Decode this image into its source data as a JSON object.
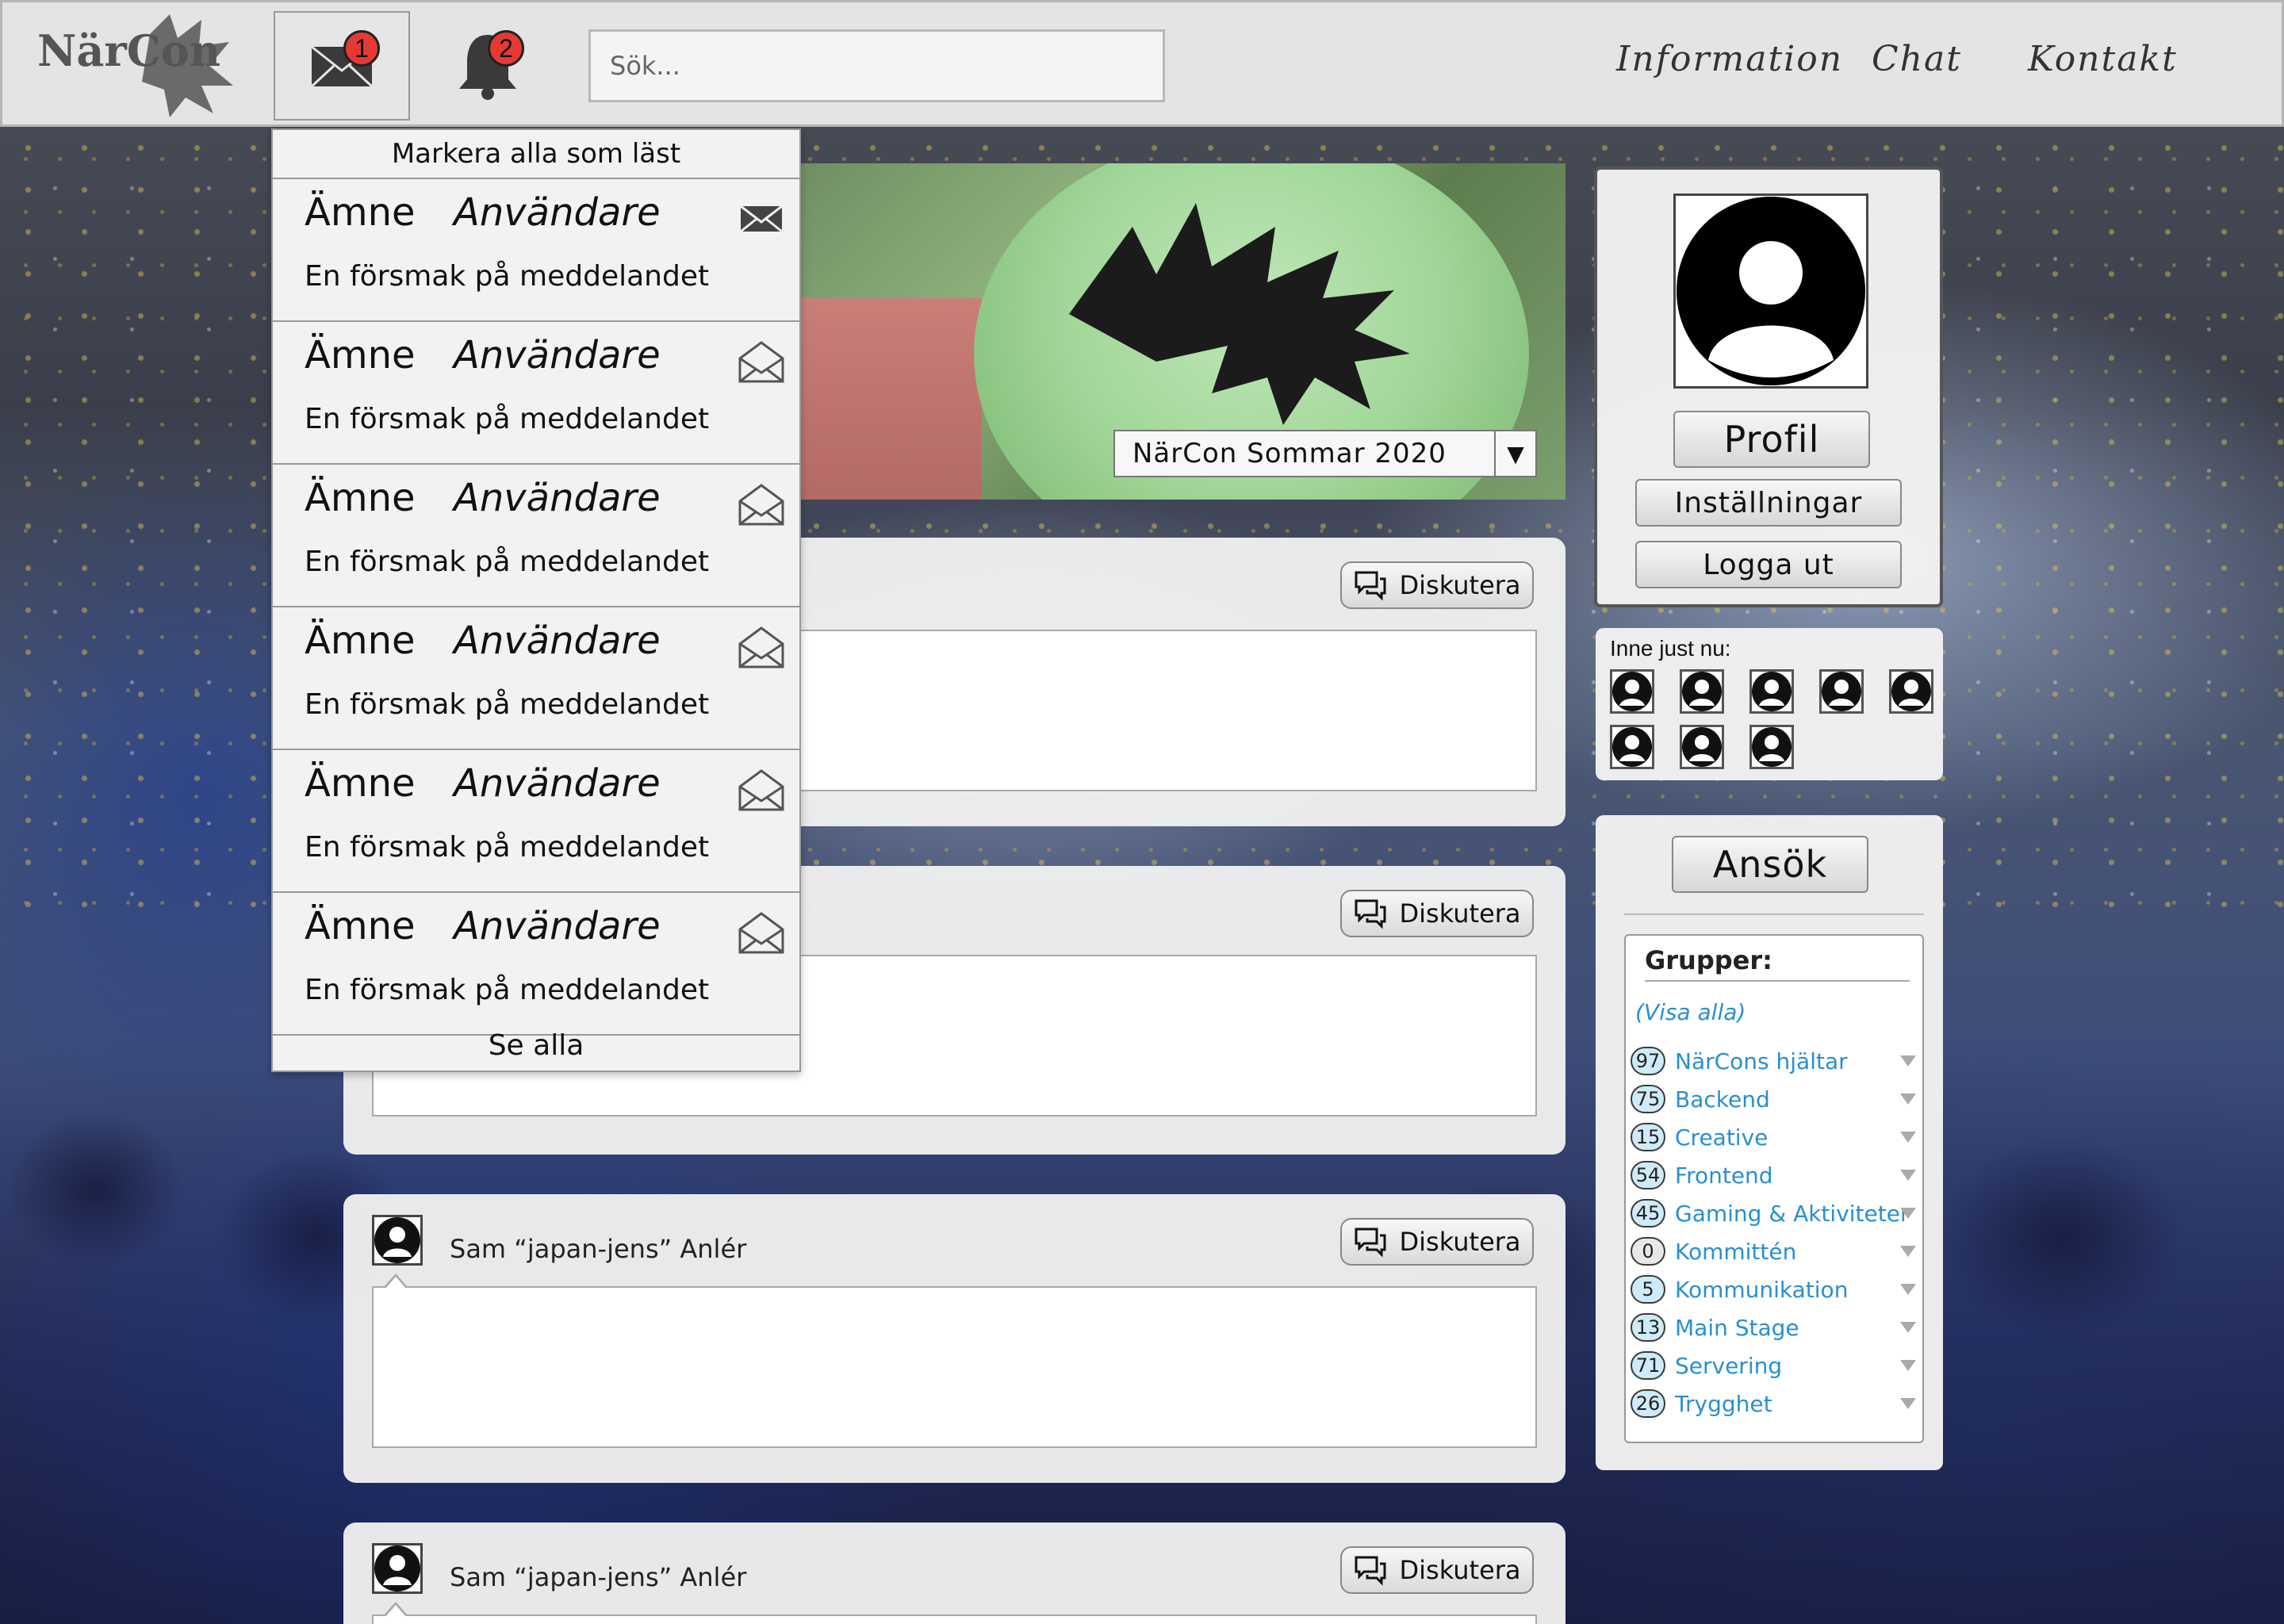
{
  "header": {
    "logo_text": "NärCon",
    "messages_badge": "1",
    "notifications_badge": "2",
    "search_placeholder": "Sök...",
    "nav": {
      "information": "Information",
      "chat": "Chat",
      "contact": "Kontakt"
    }
  },
  "banner": {
    "event_select_value": "NärCon Sommar 2020",
    "event_select_arrow": "▼"
  },
  "posts": [
    {
      "author": "",
      "discuss_label": "Diskutera"
    },
    {
      "author": "",
      "discuss_label": "Diskutera"
    },
    {
      "author": "Sam “japan-jens” Anlér",
      "discuss_label": "Diskutera"
    },
    {
      "author": "Sam “japan-jens” Anlér",
      "discuss_label": "Diskutera"
    }
  ],
  "profile": {
    "profile_label": "Profil",
    "settings_label": "Inställningar",
    "logout_label": "Logga ut"
  },
  "online": {
    "label": "Inne just nu:",
    "count": 8
  },
  "groups": {
    "apply_label": "Ansök",
    "title": "Grupper:",
    "show_all": "(Visa alla)",
    "items": [
      {
        "count": "97",
        "name": "NärCons hjältar"
      },
      {
        "count": "75",
        "name": "Backend"
      },
      {
        "count": "15",
        "name": "Creative"
      },
      {
        "count": "54",
        "name": "Frontend"
      },
      {
        "count": "45",
        "name": "Gaming & Aktiviteter"
      },
      {
        "count": "0",
        "name": "Kommittén"
      },
      {
        "count": "5",
        "name": "Kommunikation"
      },
      {
        "count": "13",
        "name": "Main Stage"
      },
      {
        "count": "71",
        "name": "Servering"
      },
      {
        "count": "26",
        "name": "Trygghet"
      }
    ]
  },
  "messages_dropdown": {
    "mark_all_read": "Markera alla som läst",
    "see_all": "Se alla",
    "items": [
      {
        "subject": "Ämne",
        "sender": "Användare",
        "preview": "En försmak på meddelandet",
        "read": false
      },
      {
        "subject": "Ämne",
        "sender": "Användare",
        "preview": "En försmak på meddelandet",
        "read": true
      },
      {
        "subject": "Ämne",
        "sender": "Användare",
        "preview": "En försmak på meddelandet",
        "read": true
      },
      {
        "subject": "Ämne",
        "sender": "Användare",
        "preview": "En försmak på meddelandet",
        "read": true
      },
      {
        "subject": "Ämne",
        "sender": "Användare",
        "preview": "En försmak på meddelandet",
        "read": true
      },
      {
        "subject": "Ämne",
        "sender": "Användare",
        "preview": "En försmak på meddelandet",
        "read": true
      }
    ]
  },
  "colors": {
    "accent_link": "#2a8fd0",
    "badge_red": "#e53935"
  }
}
